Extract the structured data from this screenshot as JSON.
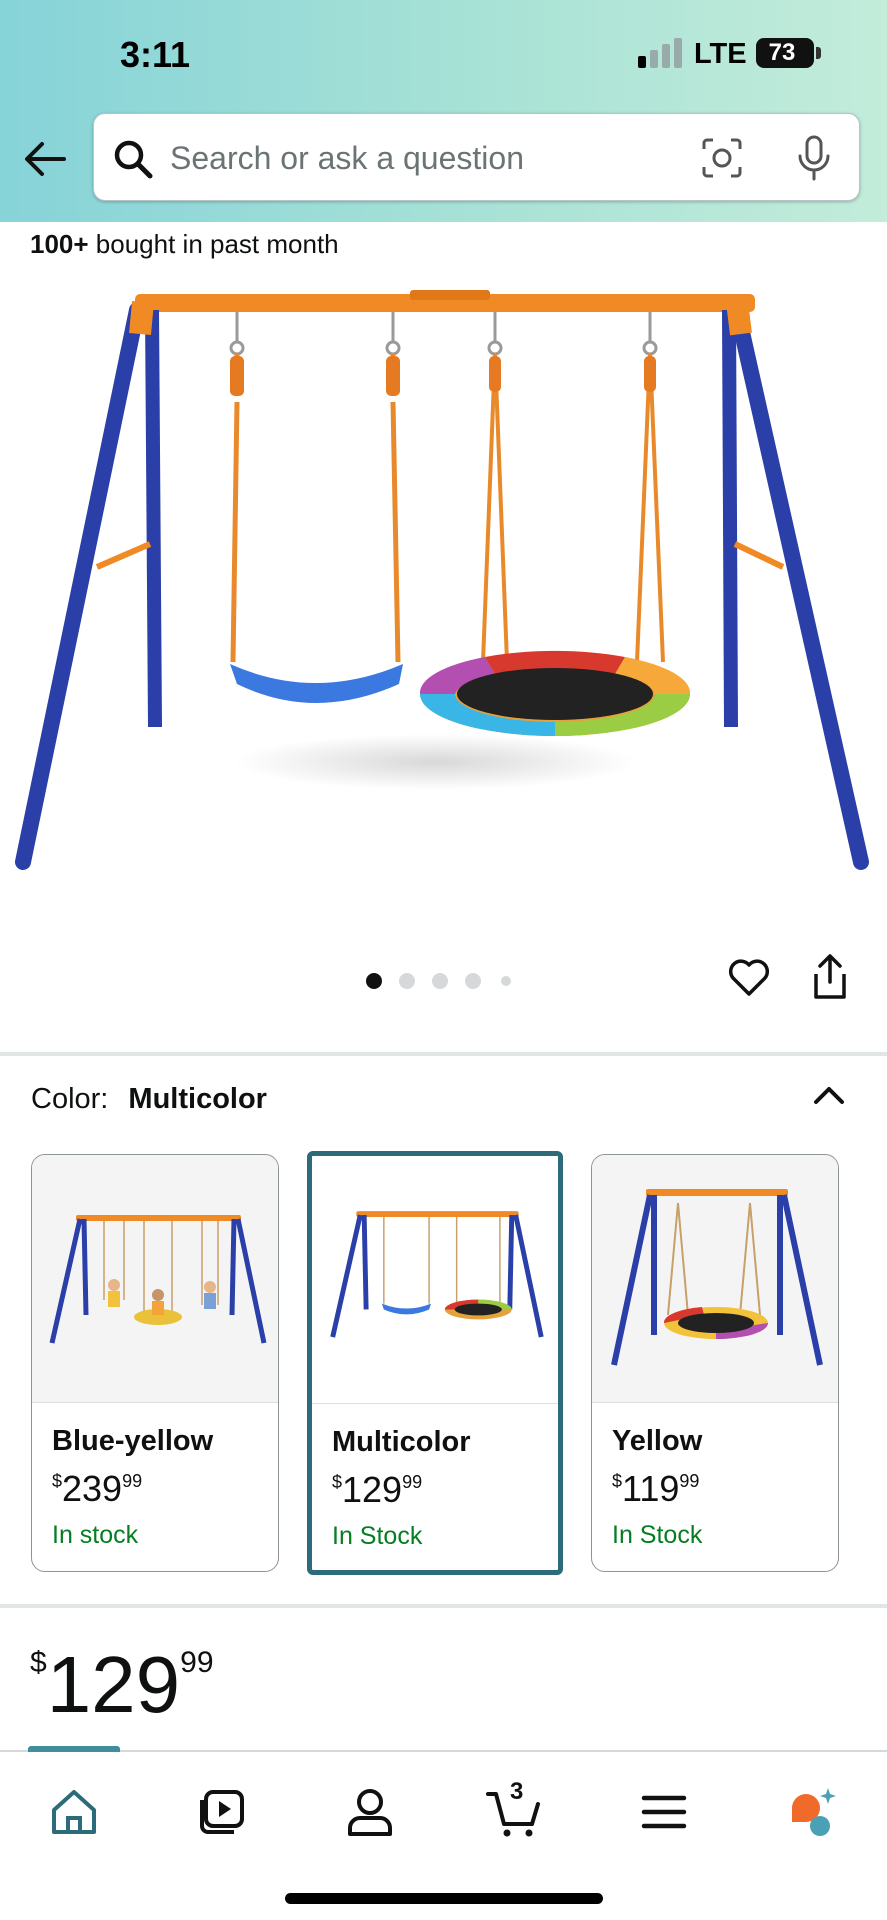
{
  "status_bar": {
    "time": "3:11",
    "network": "LTE",
    "battery": "73"
  },
  "search": {
    "placeholder": "Search or ask a question"
  },
  "product": {
    "social_proof_bold": "100+",
    "social_proof_rest": " bought in past month",
    "image_count": 5,
    "active_image": 1
  },
  "color_selector": {
    "label": "Color:",
    "selected": "Multicolor",
    "options": [
      {
        "name": "Blue-yellow",
        "price_whole": "239",
        "price_cents": "99",
        "currency": "$",
        "stock": "In stock"
      },
      {
        "name": "Multicolor",
        "price_whole": "129",
        "price_cents": "99",
        "currency": "$",
        "stock": "In Stock"
      },
      {
        "name": "Yellow",
        "price_whole": "119",
        "price_cents": "99",
        "currency": "$",
        "stock": "In Stock"
      }
    ]
  },
  "price": {
    "currency": "$",
    "whole": "129",
    "cents": "99"
  },
  "tabbar": {
    "items": [
      {
        "icon": "home-icon"
      },
      {
        "icon": "video-icon"
      },
      {
        "icon": "account-icon"
      },
      {
        "icon": "cart-icon",
        "badge": "3"
      },
      {
        "icon": "menu-icon"
      },
      {
        "icon": "rufus-icon"
      }
    ]
  },
  "colors": {
    "accent_teal": "#2b6b7a",
    "in_stock_green": "#067d22",
    "frame_blue": "#2a3fa8",
    "frame_orange": "#f08a24"
  }
}
